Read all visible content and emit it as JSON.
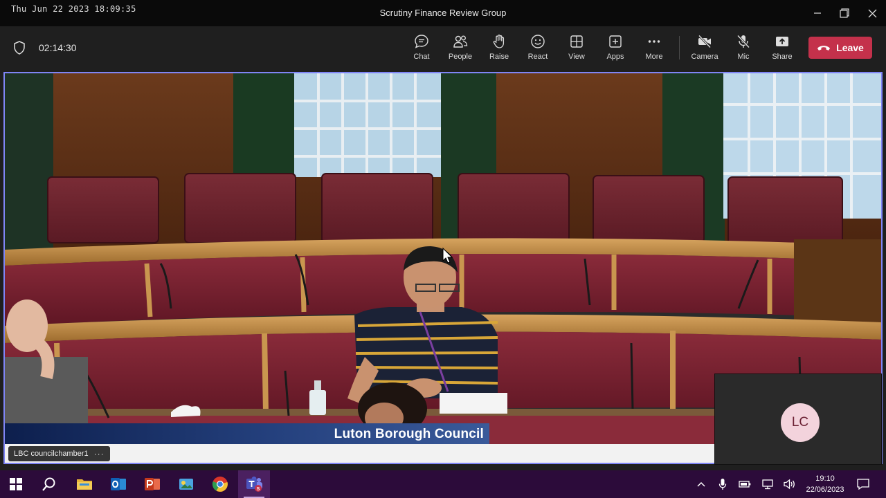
{
  "titlebar": {
    "datetime": "Thu Jun 22 2023 18:09:35",
    "title": "Scrutiny Finance Review Group",
    "minimize_icon": "minimize-icon",
    "restore_icon": "restore-icon",
    "close_icon": "close-icon"
  },
  "toolbar": {
    "timer": "02:14:30",
    "buttons": [
      {
        "label": "Chat",
        "icon": "chat-icon"
      },
      {
        "label": "People",
        "icon": "people-icon"
      },
      {
        "label": "Raise",
        "icon": "raise-hand-icon"
      },
      {
        "label": "React",
        "icon": "react-smiley-icon"
      },
      {
        "label": "View",
        "icon": "view-grid-icon"
      },
      {
        "label": "Apps",
        "icon": "apps-plus-icon"
      },
      {
        "label": "More",
        "icon": "more-dots-icon"
      },
      {
        "label": "Camera",
        "icon": "camera-off-icon"
      },
      {
        "label": "Mic",
        "icon": "mic-off-icon"
      },
      {
        "label": "Share",
        "icon": "share-icon"
      }
    ],
    "leave_label": "Leave",
    "leave_color": "#c4314b"
  },
  "stage": {
    "broadcast_banner": "Luton Borough Council",
    "participant_name": "LBC councilchamber1",
    "participant_more": "···",
    "self_view_initials": "LC",
    "accent_border": "#7f85f5"
  },
  "taskbar": {
    "apps": [
      "windows-start-icon",
      "search-icon",
      "file-explorer-icon",
      "outlook-icon",
      "powerpoint-icon",
      "paint-icon",
      "chrome-icon",
      "teams-icon"
    ],
    "active_app": "teams-icon",
    "time": "19:10",
    "date": "22/06/2023"
  }
}
